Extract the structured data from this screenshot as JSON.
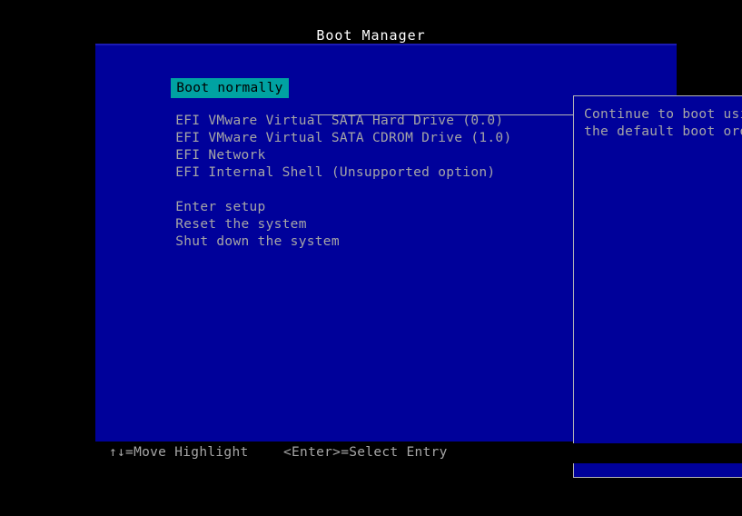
{
  "screen": {
    "title": "Boot Manager",
    "background_color": "#000000",
    "window_color": "#00019a",
    "text_color": "#a6a6a6",
    "highlight_bg_color": "#00a2a2",
    "highlight_fg_color": "#000000",
    "border_color": "#b5b5b5",
    "title_color": "#ffffff"
  },
  "menu": {
    "items": [
      {
        "label": "Boot normally",
        "selected": true,
        "group": 0
      },
      {
        "label": "EFI VMware Virtual SATA Hard Drive (0.0)",
        "selected": false,
        "group": 1
      },
      {
        "label": "EFI VMware Virtual SATA CDROM Drive (1.0)",
        "selected": false,
        "group": 1
      },
      {
        "label": "EFI Network",
        "selected": false,
        "group": 1
      },
      {
        "label": "EFI Internal Shell (Unsupported option)",
        "selected": false,
        "group": 1
      },
      {
        "label": "Enter setup",
        "selected": false,
        "group": 2
      },
      {
        "label": "Reset the system",
        "selected": false,
        "group": 2
      },
      {
        "label": "Shut down the system",
        "selected": false,
        "group": 2
      }
    ]
  },
  "help_panel": {
    "lines": [
      "Continue to boot using",
      "the default boot order."
    ]
  },
  "footer": {
    "hint_move": "↑↓=Move Highlight",
    "hint_select": "<Enter>=Select Entry"
  }
}
